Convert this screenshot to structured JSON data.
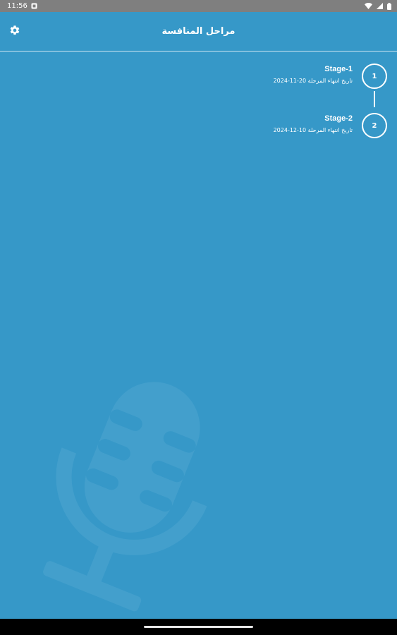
{
  "status_bar": {
    "time": "11:56",
    "icons": [
      "notification-icon",
      "wifi-icon",
      "signal-icon",
      "battery-icon"
    ]
  },
  "app_bar": {
    "title": "مراحل المنافسة",
    "settings_icon": "gear-icon"
  },
  "stages": [
    {
      "number": "1",
      "name": "Stage-1",
      "end_date_label": "تاريخ انتهاء المرحلة",
      "end_date": "20-11-2024"
    },
    {
      "number": "2",
      "name": "Stage-2",
      "end_date_label": "تاريخ انتهاء المرحلة",
      "end_date": "10-12-2024"
    }
  ],
  "colors": {
    "background": "#3698c8",
    "status_bar": "#7f7f7f",
    "nav_bar": "#000000",
    "foreground": "#ffffff"
  },
  "decorations": {
    "watermark_icon": "microphone-icon"
  }
}
